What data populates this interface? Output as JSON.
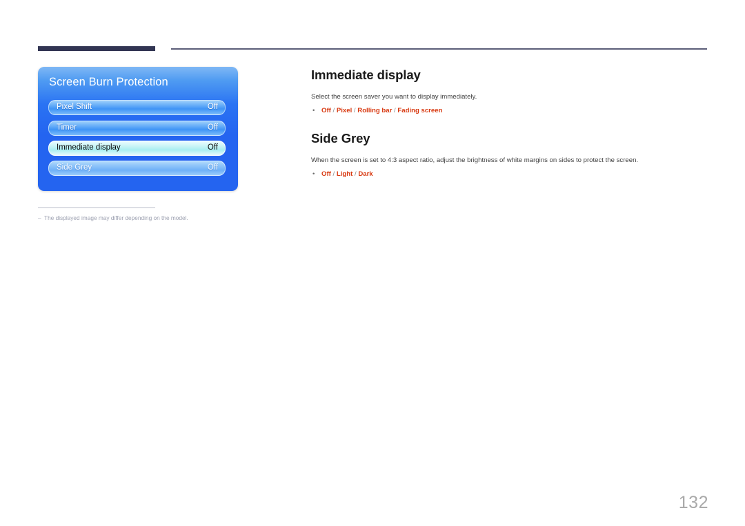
{
  "page": {
    "number": "132",
    "footnote_dash": "–",
    "footnote": "The displayed image may differ depending on the model."
  },
  "osd_panel": {
    "title": "Screen Burn Protection",
    "rows": [
      {
        "label": "Pixel Shift",
        "value": "Off",
        "state": "normal"
      },
      {
        "label": "Timer",
        "value": "Off",
        "state": "normal"
      },
      {
        "label": "Immediate display",
        "value": "Off",
        "state": "selected"
      },
      {
        "label": "Side Grey",
        "value": "Off",
        "state": "dim"
      }
    ]
  },
  "content": {
    "sections": [
      {
        "heading": "Immediate display",
        "description": "Select the screen saver you want to display immediately.",
        "options": [
          "Off",
          "Pixel",
          "Rolling bar",
          "Fading screen"
        ],
        "option_separator": " / "
      },
      {
        "heading": "Side Grey",
        "description": "When the screen is set to 4:3 aspect ratio, adjust the brightness of white margins on sides to protect the screen.",
        "options": [
          "Off",
          "Light",
          "Dark"
        ],
        "option_separator": " / "
      }
    ]
  },
  "colors": {
    "accent_red": "#d8380f",
    "rule_dark": "#323553",
    "rule_thin": "#5b5d78",
    "panel_blue": "#2464f0",
    "page_number_grey": "#a9a9a9"
  }
}
